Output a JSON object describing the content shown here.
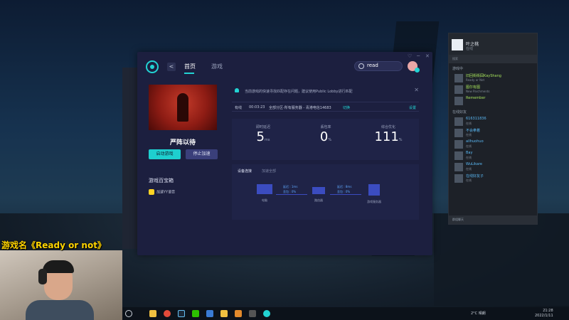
{
  "overlay": {
    "game_name": "游戏名《Ready or not》"
  },
  "side_panel": {
    "label1": "主页",
    "label2": "游戏"
  },
  "app": {
    "nav": {
      "back": "<",
      "home": "首页",
      "games": "游戏"
    },
    "search": {
      "value": "read"
    },
    "window_controls": {
      "skin": "♡",
      "minimize": "─",
      "close": "✕"
    },
    "game": {
      "title": "严阵以待",
      "start_label": "启动游戏",
      "stop_label": "停止加速"
    },
    "toolbox": {
      "title": "游戏百宝箱",
      "item": "加速YY语音"
    },
    "notice": {
      "text": "当前游戏的快速寻找匹配存在问题，建议使用Public Lobby进行匹配",
      "close": "✕"
    },
    "status": {
      "mode": "有线",
      "time": "00:03:23",
      "region": "全部分区-所有服务器 - 青港电信14683",
      "switch_label": "切换",
      "settings_label": "设置"
    },
    "stats": [
      {
        "label": "即时延迟",
        "value": "5",
        "unit": "ms"
      },
      {
        "label": "丢包率",
        "value": "0",
        "unit": "%"
      },
      {
        "label": "综合优化",
        "value": "111",
        "unit": "%"
      }
    ],
    "connection": {
      "tab_active": "设备连接",
      "tab_other": "加速全部",
      "devices": [
        "电脑",
        "路由器",
        "游戏服务器"
      ],
      "link1": {
        "latency": "延迟 : 1ms",
        "loss": "丢包 : 0%"
      },
      "link2": {
        "latency": "延迟 : 8ms",
        "loss": "丢包 : 0%"
      }
    }
  },
  "friends": {
    "user_name": "叶之桃",
    "user_status": "在线",
    "search_placeholder": "搜索",
    "section_ingame": "游戏中",
    "section_online": "在线好友",
    "ingame": [
      {
        "name": "旧回街街囧KayShang",
        "status": "Ready or Not"
      },
      {
        "name": "图尔有图",
        "status": "New Parchments"
      },
      {
        "name": "Remember",
        "status": ""
      }
    ],
    "online": [
      {
        "name": "616311836",
        "status": "在线"
      },
      {
        "name": "不会拳着",
        "status": "在线"
      },
      {
        "name": "allhuohuo",
        "status": "在线"
      },
      {
        "name": "Bay",
        "status": "在线"
      },
      {
        "name": "WuLikare",
        "status": "在线"
      },
      {
        "name": "在线好友子",
        "status": "在线"
      }
    ],
    "footer": "群组聊天"
  },
  "taskbar": {
    "weather": "2°C 晴朗",
    "time": "21:28",
    "date": "2022/1/11"
  },
  "colors": {
    "accent": "#22d3d3",
    "window_bg": "#1c1f3f",
    "overlay_text": "#ffd400"
  }
}
